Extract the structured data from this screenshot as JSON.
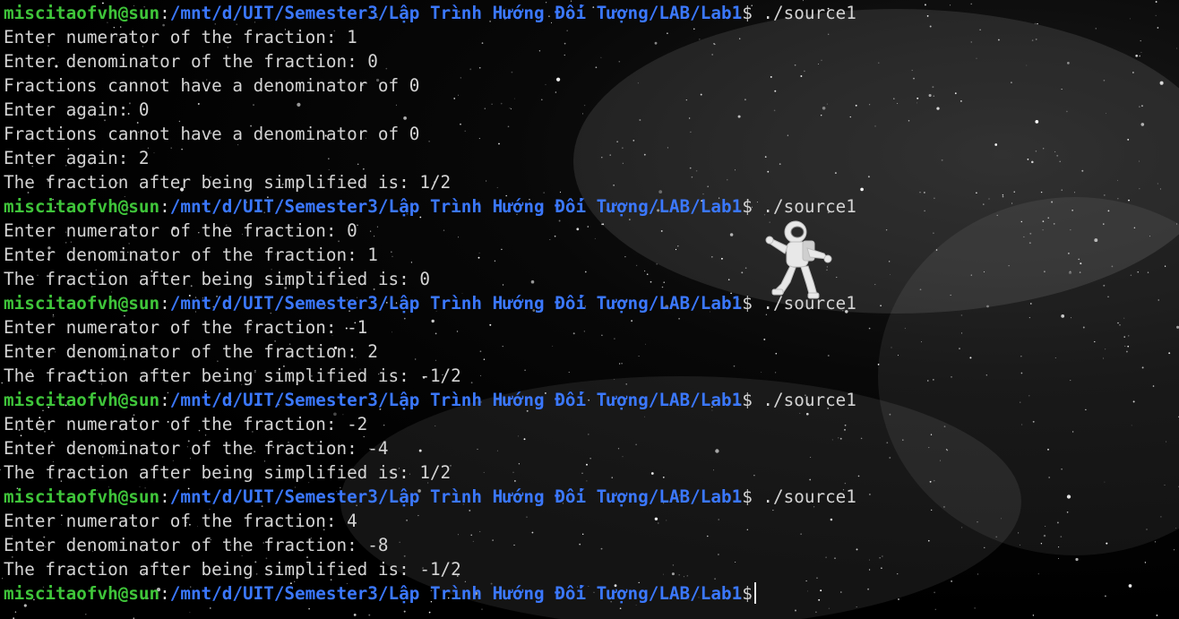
{
  "terminal": {
    "prompt_user": "miscitaofvh@sun",
    "prompt_path": "/mnt/d/UIT/Semester3/Lập Trình Hướng Đối Tượng/LAB/Lab1",
    "prompt_symbol": "$",
    "lines": [
      {
        "type": "prompt",
        "command": " ./source1"
      },
      {
        "type": "output",
        "text": "Enter numerator of the fraction: 1"
      },
      {
        "type": "output",
        "text": "Enter denominator of the fraction: 0"
      },
      {
        "type": "output",
        "text": "Fractions cannot have a denominator of 0"
      },
      {
        "type": "output",
        "text": "Enter again: 0"
      },
      {
        "type": "output",
        "text": "Fractions cannot have a denominator of 0"
      },
      {
        "type": "output",
        "text": "Enter again: 2"
      },
      {
        "type": "output",
        "text": "The fraction after being simplified is: 1/2"
      },
      {
        "type": "prompt",
        "command": " ./source1"
      },
      {
        "type": "output",
        "text": "Enter numerator of the fraction: 0"
      },
      {
        "type": "output",
        "text": "Enter denominator of the fraction: 1"
      },
      {
        "type": "output",
        "text": "The fraction after being simplified is: 0"
      },
      {
        "type": "prompt",
        "command": " ./source1"
      },
      {
        "type": "output",
        "text": "Enter numerator of the fraction: -1"
      },
      {
        "type": "output",
        "text": "Enter denominator of the fraction: 2"
      },
      {
        "type": "output",
        "text": "The fraction after being simplified is: -1/2"
      },
      {
        "type": "prompt",
        "command": " ./source1"
      },
      {
        "type": "output",
        "text": "Enter numerator of the fraction: -2"
      },
      {
        "type": "output",
        "text": "Enter denominator of the fraction: -4"
      },
      {
        "type": "output",
        "text": "The fraction after being simplified is: 1/2"
      },
      {
        "type": "prompt",
        "command": " ./source1"
      },
      {
        "type": "output",
        "text": "Enter numerator of the fraction: 4"
      },
      {
        "type": "output",
        "text": "Enter denominator of the fraction: -8"
      },
      {
        "type": "output",
        "text": "The fraction after being simplified is: -1/2"
      },
      {
        "type": "prompt",
        "command": ""
      }
    ]
  },
  "background": {
    "image": "astronaut-icon",
    "colors": {
      "background": "#000000",
      "text": "#d4d4d4",
      "user": "#3fc53a",
      "path": "#3b78ff"
    }
  }
}
